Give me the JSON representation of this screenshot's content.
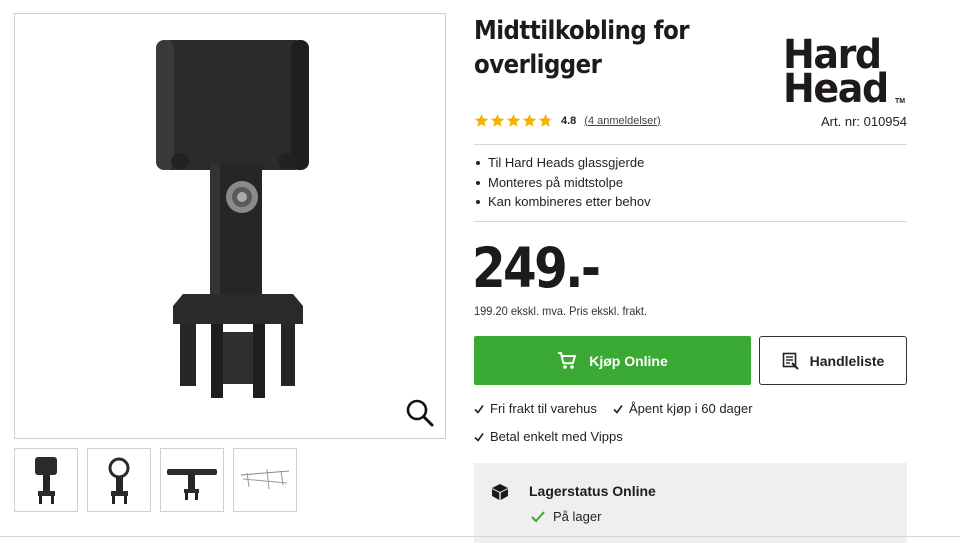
{
  "product": {
    "title_line1": "Midttilkobling for",
    "title_line2": "overligger",
    "brand_logo_text_line1": "Hard",
    "brand_logo_text_line2": "Head",
    "brand_logo_tm": "TM",
    "rating_value": "4.8",
    "rating_stars": 4.8,
    "reviews_link": "(4 anmeldelser)",
    "article_number": "Art. nr: 010954",
    "features": [
      "Til Hard Heads glassgjerde",
      "Monteres på midtstolpe",
      "Kan kombineres etter behov"
    ],
    "price": "249.-",
    "price_sub": "199.20 ekskl. mva. Pris ekskl. frakt."
  },
  "actions": {
    "buy_label": "Kjøp Online",
    "shopping_list_label": "Handleliste"
  },
  "usps": {
    "free_shipping": "Fri frakt til varehus",
    "open_purchase": "Åpent kjøp i 60 dager",
    "vipps": "Betal enkelt med Vipps"
  },
  "stock": {
    "title": "Lagerstatus Online",
    "status": "På lager"
  },
  "gallery": {
    "thumbnail_count": 4
  },
  "colors": {
    "buy_green": "#3aaa35",
    "star_yellow": "#f2b400",
    "stock_bg": "#efefee",
    "check_green": "#3aaa35"
  },
  "icons": {
    "zoom": "magnifier-icon",
    "cart": "shopping-cart-icon",
    "list": "shopping-list-icon",
    "check": "check-icon",
    "box": "package-icon"
  }
}
